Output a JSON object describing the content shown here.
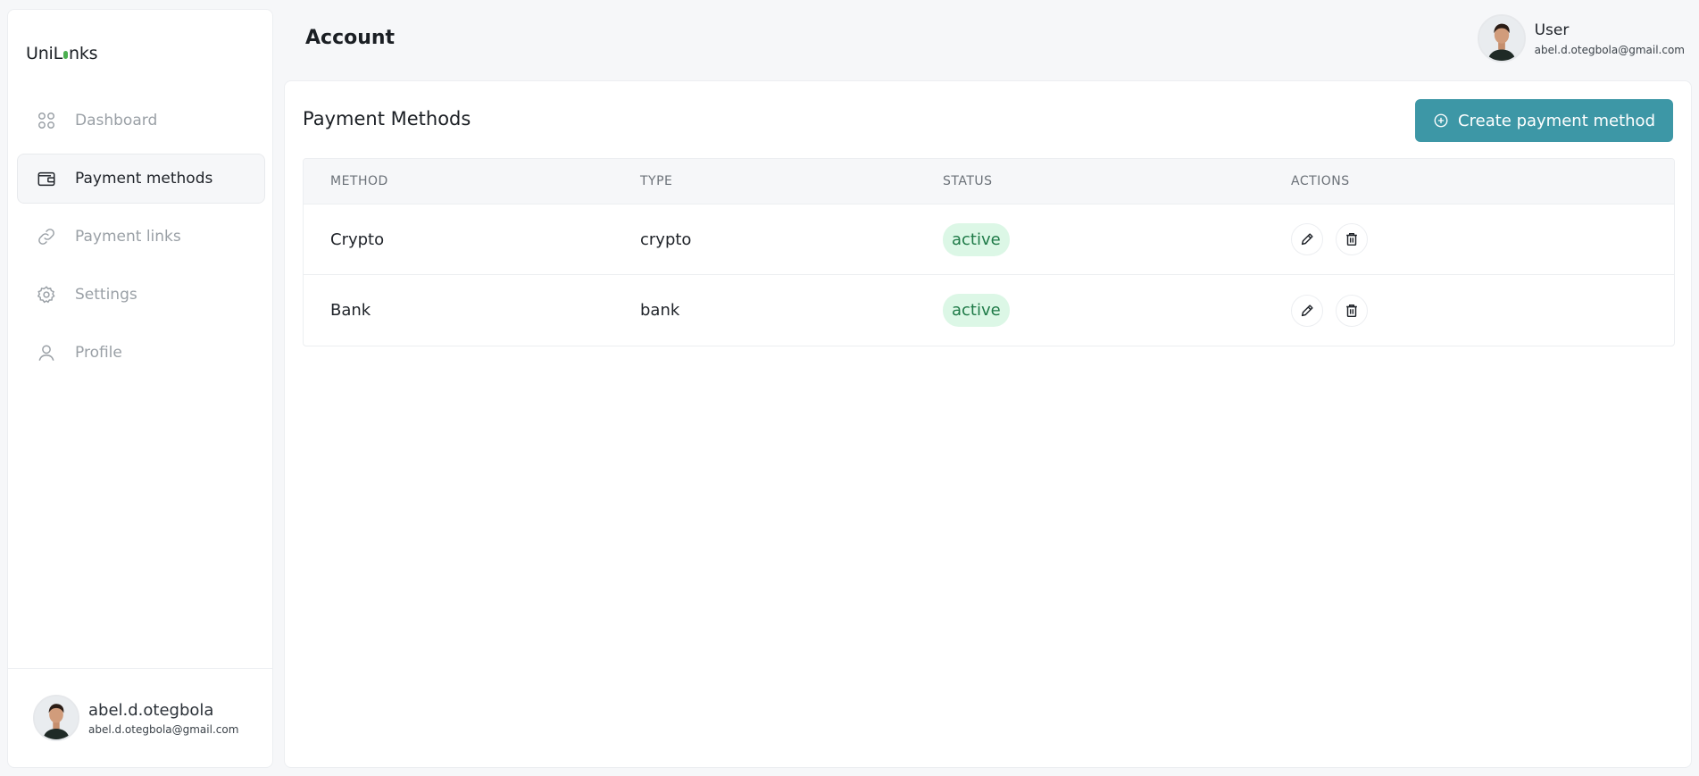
{
  "app": {
    "logo_left": "UniL",
    "logo_right": "nks"
  },
  "sidebar": {
    "items": [
      {
        "label": "Dashboard",
        "icon": "grid-icon"
      },
      {
        "label": "Payment methods",
        "icon": "wallet-icon",
        "active": true
      },
      {
        "label": "Payment links",
        "icon": "link-icon"
      },
      {
        "label": "Settings",
        "icon": "gear-icon"
      },
      {
        "label": "Profile",
        "icon": "user-icon"
      }
    ],
    "user": {
      "name": "abel.d.otegbola",
      "email": "abel.d.otegbola@gmail.com"
    }
  },
  "header": {
    "title": "Account",
    "user": {
      "role": "User",
      "email": "abel.d.otegbola@gmail.com"
    }
  },
  "main": {
    "title": "Payment Methods",
    "create_label": "Create payment method",
    "columns": [
      "METHOD",
      "TYPE",
      "STATUS",
      "ACTIONS"
    ],
    "rows": [
      {
        "method": "Crypto",
        "type": "crypto",
        "status": "active"
      },
      {
        "method": "Bank",
        "type": "bank",
        "status": "active"
      }
    ]
  },
  "colors": {
    "accent": "#3d97a6",
    "status_bg": "#dcf7e6",
    "status_fg": "#1e7a47",
    "logo_dot": "#4caf50"
  }
}
